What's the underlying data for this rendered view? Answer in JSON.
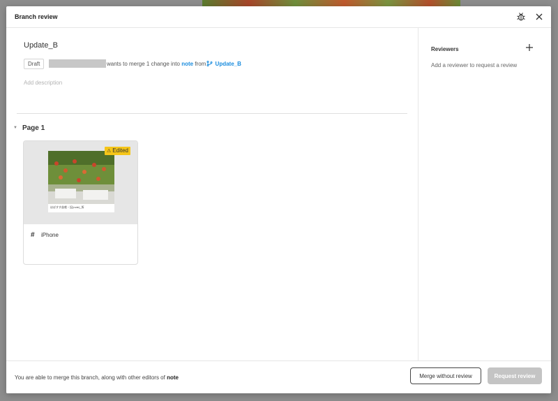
{
  "modal": {
    "title": "Branch review",
    "header_icons": [
      "bug-icon",
      "close-icon"
    ]
  },
  "branch": {
    "name": "Update_B",
    "status_badge": "Draft",
    "merge_text": "wants to merge 1 change into",
    "target": "note",
    "from_word": "from",
    "source": "Update_B",
    "description_placeholder": "Add description"
  },
  "page_section": {
    "label": "Page 1",
    "frames": [
      {
        "name": "iPhone",
        "badge": "Edited",
        "thumbnail_caption": "はばすす苗栽・記(note)_所"
      }
    ]
  },
  "reviewers": {
    "title": "Reviewers",
    "hint": "Add a reviewer to request a review"
  },
  "footer": {
    "message": "You are able to merge this branch, along with other editors of",
    "file_name": "note",
    "merge_button": "Merge without review",
    "request_button": "Request review"
  },
  "colors": {
    "link": "#1a8cde",
    "badge_edited": "#f5c518",
    "disabled_button": "#c4c4c4"
  }
}
